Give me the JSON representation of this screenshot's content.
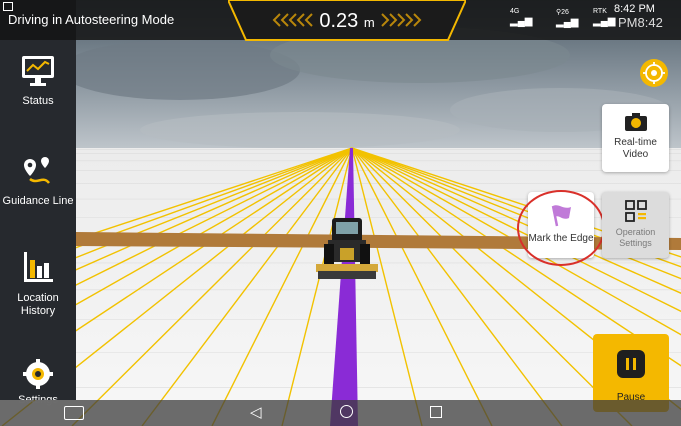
{
  "status_bar": {
    "title": "Driving in Autosteering Mode",
    "deviation_value": "0.23",
    "deviation_unit": "m",
    "network_4g": "4G",
    "network_sats": "26",
    "network_rtk": "RTK",
    "time": "8:42 PM",
    "time_shadow": "PM8:42"
  },
  "sidebar": {
    "items": [
      {
        "label": "Status",
        "icon": "monitor-icon"
      },
      {
        "label": "Guidance Line",
        "icon": "route-icon"
      },
      {
        "label": "Location History",
        "icon": "bar-chart-icon"
      },
      {
        "label": "Settings",
        "icon": "gear-icon"
      }
    ]
  },
  "actions": {
    "realtime_video": "Real-time Video",
    "mark_edge": "Mark the Edge",
    "operation_settings": "Operation Settings",
    "pause": "Pause"
  },
  "colors": {
    "accent": "#f4b800",
    "guidance": "#8a2bd6",
    "field_lines": "#f2c200",
    "highlight_ring": "#d9302a"
  }
}
